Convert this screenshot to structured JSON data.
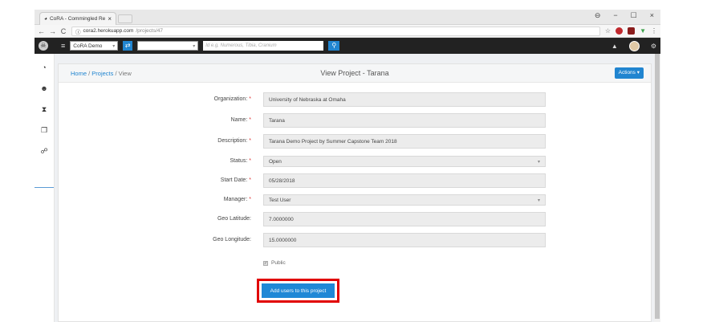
{
  "browser": {
    "tab_title": "CoRA - Commingled Re",
    "tab_close": "×",
    "url_host": "cora2.herokuapp.com",
    "url_path": "/projects/47",
    "window_controls": [
      "⊖",
      "−",
      "☐",
      "×"
    ]
  },
  "navbar": {
    "project_select": "CoRA Demo",
    "search_placeholder": "Id e.g. Numerous, Tibia, Cranium"
  },
  "breadcrumb": {
    "home": "Home",
    "sep1": " / ",
    "projects": "Projects",
    "sep2": " / ",
    "current": "View"
  },
  "page": {
    "title": "View Project - Tarana",
    "actions_label": "Actions ▾"
  },
  "form": {
    "organization": {
      "label": "Organization:",
      "value": "University of Nebraska at Omaha"
    },
    "name": {
      "label": "Name:",
      "value": "Tarana"
    },
    "description": {
      "label": "Description:",
      "value": "Tarana Demo Project by Summer Capstone Team 2018"
    },
    "status": {
      "label": "Status:",
      "value": "Open"
    },
    "start_date": {
      "label": "Start Date:",
      "value": "05/28/2018"
    },
    "manager": {
      "label": "Manager:",
      "value": "Test User"
    },
    "geo_latitude": {
      "label": "Geo Latitude:",
      "value": "7.0000000"
    },
    "geo_longitude": {
      "label": "Geo Longitude:",
      "value": "15.0000000"
    },
    "public_label": "Public",
    "public_checked": true,
    "required_mark": "*"
  },
  "add_users_button": "Add users to this project",
  "colors": {
    "accent": "#2185d0",
    "highlight": "#e10000",
    "navbar": "#222222"
  },
  "sidebar_icons": [
    "dashboard-icon",
    "skull-icon",
    "hourglass-icon",
    "copy-icon",
    "users-icon"
  ]
}
